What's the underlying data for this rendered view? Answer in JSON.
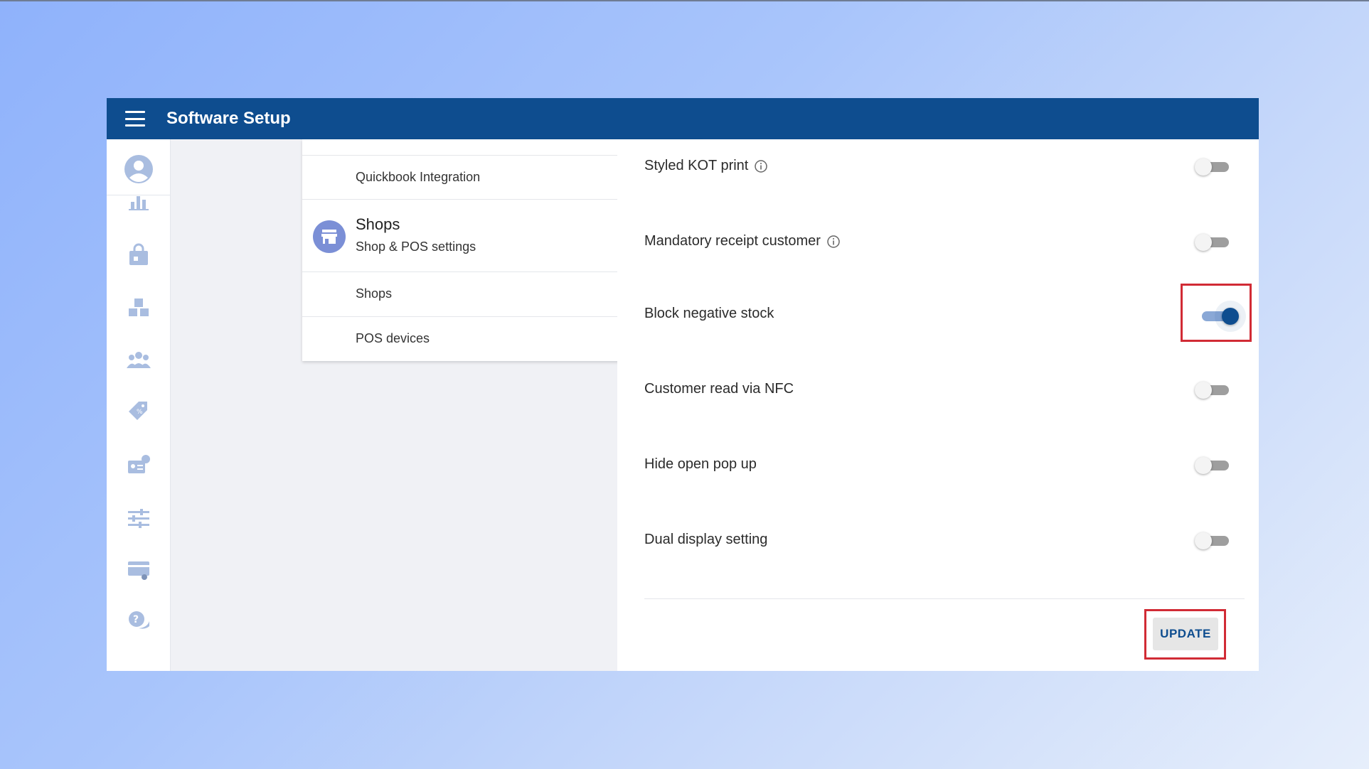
{
  "app": {
    "title": "Software Setup"
  },
  "menu": {
    "items": [
      {
        "label": "Quickbook Integration"
      }
    ],
    "section": {
      "title": "Shops",
      "subtitle": "Shop & POS settings",
      "items": [
        {
          "label": "Shops"
        },
        {
          "label": "POS devices"
        }
      ]
    }
  },
  "settings": {
    "rows": [
      {
        "label": "Styled KOT print",
        "info": true,
        "enabled": false
      },
      {
        "label": "Mandatory receipt customer",
        "info": true,
        "enabled": false
      },
      {
        "label": "Block negative stock",
        "info": false,
        "enabled": true
      },
      {
        "label": "Customer read via NFC",
        "info": false,
        "enabled": false
      },
      {
        "label": "Hide open pop up",
        "info": false,
        "enabled": false
      },
      {
        "label": "Dual display setting",
        "info": false,
        "enabled": false
      }
    ],
    "update_label": "UPDATE"
  },
  "colors": {
    "primary": "#0e4d8f",
    "highlight": "#d12b35",
    "rail_icon": "#a9bde0"
  }
}
